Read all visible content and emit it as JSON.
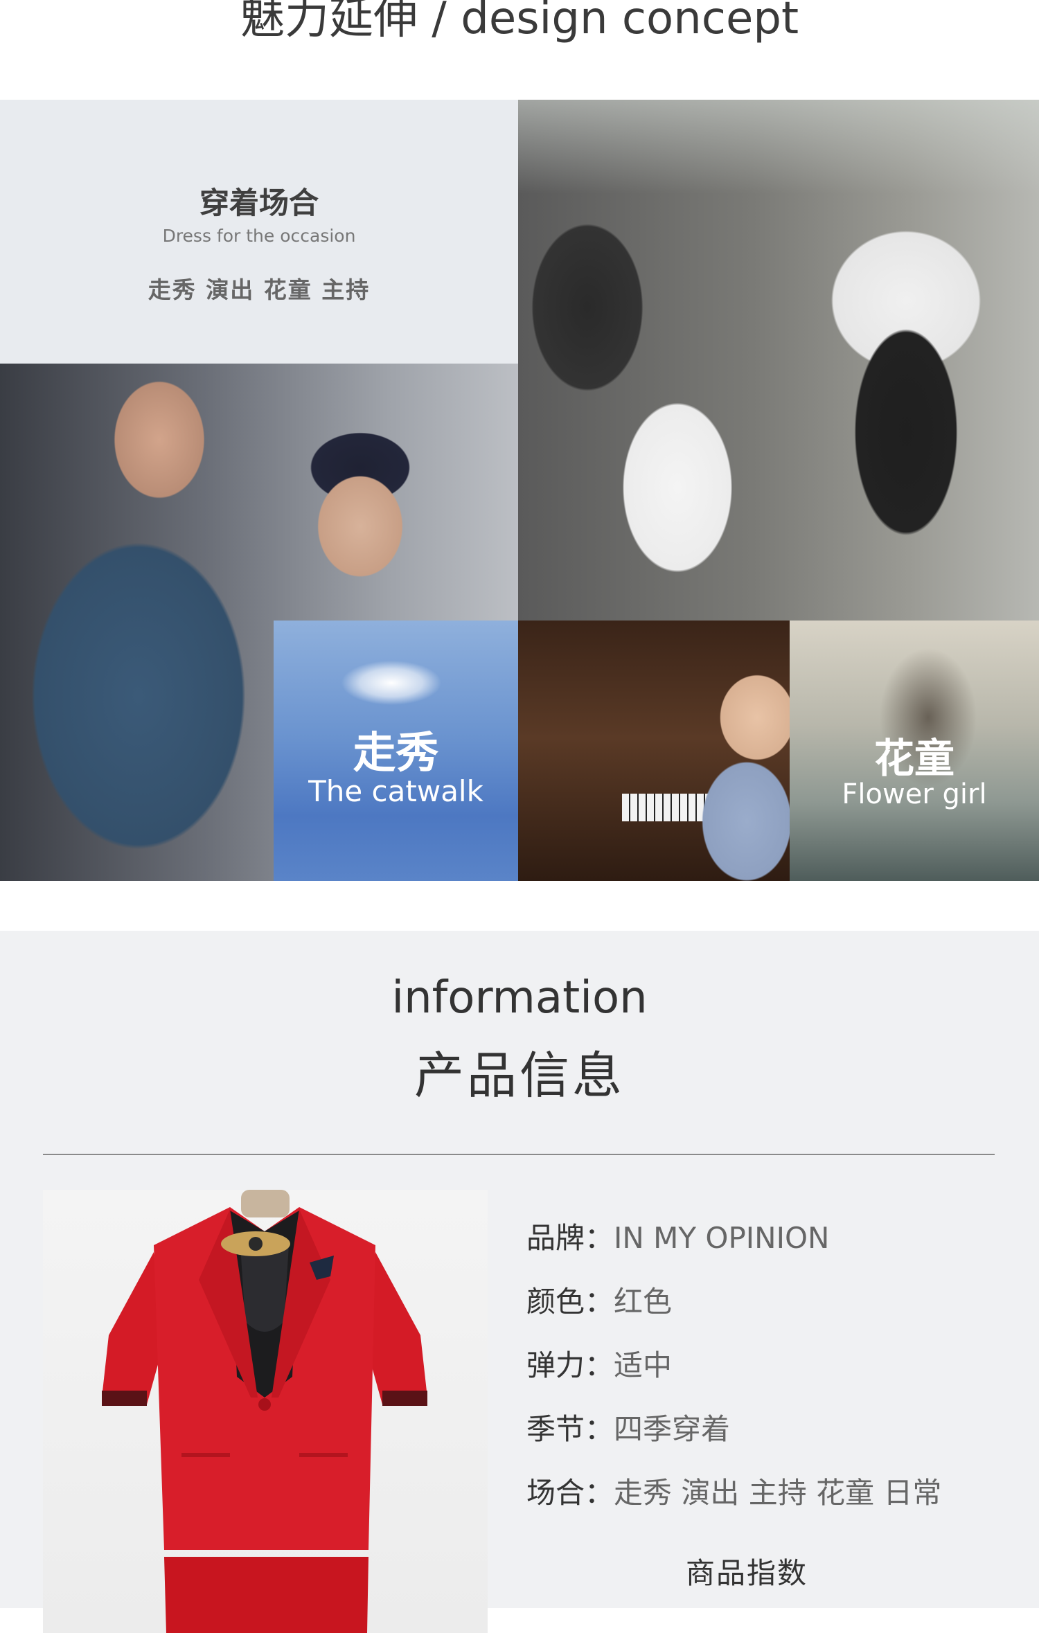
{
  "header": {
    "title": "魅力延伸 / design concept"
  },
  "occasion": {
    "title": "穿着场合",
    "subtitle": "Dress for the occasion",
    "tags": "走秀 演出 花童 主持"
  },
  "tiles": {
    "catwalk": {
      "cn": "走秀",
      "en": "The catwalk"
    },
    "flower": {
      "cn": "花童",
      "en": "Flower girl"
    }
  },
  "info": {
    "title_en": "information",
    "title_cn": "产品信息",
    "specs": [
      {
        "label": "品牌：",
        "value": "IN MY OPINION"
      },
      {
        "label": "颜色：",
        "value": "红色"
      },
      {
        "label": "弹力：",
        "value": "适中"
      },
      {
        "label": "季节：",
        "value": "四季穿着"
      },
      {
        "label": "场合：",
        "value": "走秀 演出 主持 花童 日常"
      }
    ],
    "index_title": "商品指数"
  },
  "colors": {
    "suit_red": "#d81e2a",
    "panel_bg": "#e8ebef",
    "info_bg": "#f0f1f3"
  }
}
